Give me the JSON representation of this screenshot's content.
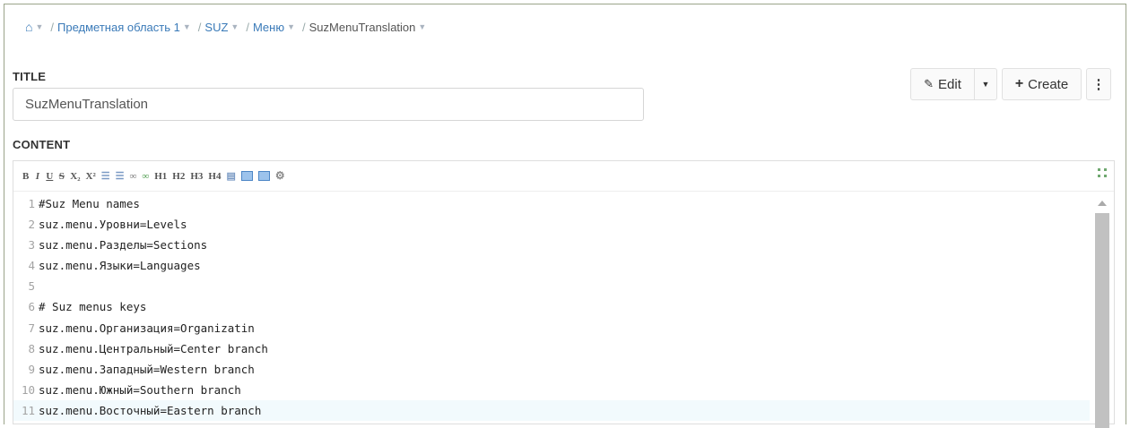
{
  "breadcrumb": {
    "home_icon": "home-icon",
    "items": [
      "Предметная область 1",
      "SUZ",
      "Меню",
      "SuzMenuTranslation"
    ]
  },
  "title_label": "TITLE",
  "title_value": "SuzMenuTranslation",
  "content_label": "CONTENT",
  "actions": {
    "edit_label": "Edit",
    "create_label": "Create"
  },
  "toolbar_items": [
    "B",
    "I",
    "U",
    "S",
    "X₂",
    "X²",
    "H1",
    "H2",
    "H3",
    "H4"
  ],
  "editor": {
    "line_numbers": [
      "1",
      "2",
      "3",
      "4",
      "5",
      "6",
      "7",
      "8",
      "9",
      "10",
      "11"
    ],
    "lines": [
      "#Suz Menu names",
      "suz.menu.Уровни=Levels",
      "suz.menu.Разделы=Sections",
      "suz.menu.Языки=Languages",
      "",
      "# Suz menus keys",
      "suz.menu.Организация=Organizatin",
      "suz.menu.Центральный=Center branch",
      "suz.menu.Западный=Western branch",
      "suz.menu.Южный=Southern branch",
      "suz.menu.Восточный=Eastern branch"
    ]
  },
  "colors": {
    "link": "#3a7ab8",
    "frame_border": "#9aa48a",
    "scrollbar": "#c1c1c1"
  }
}
